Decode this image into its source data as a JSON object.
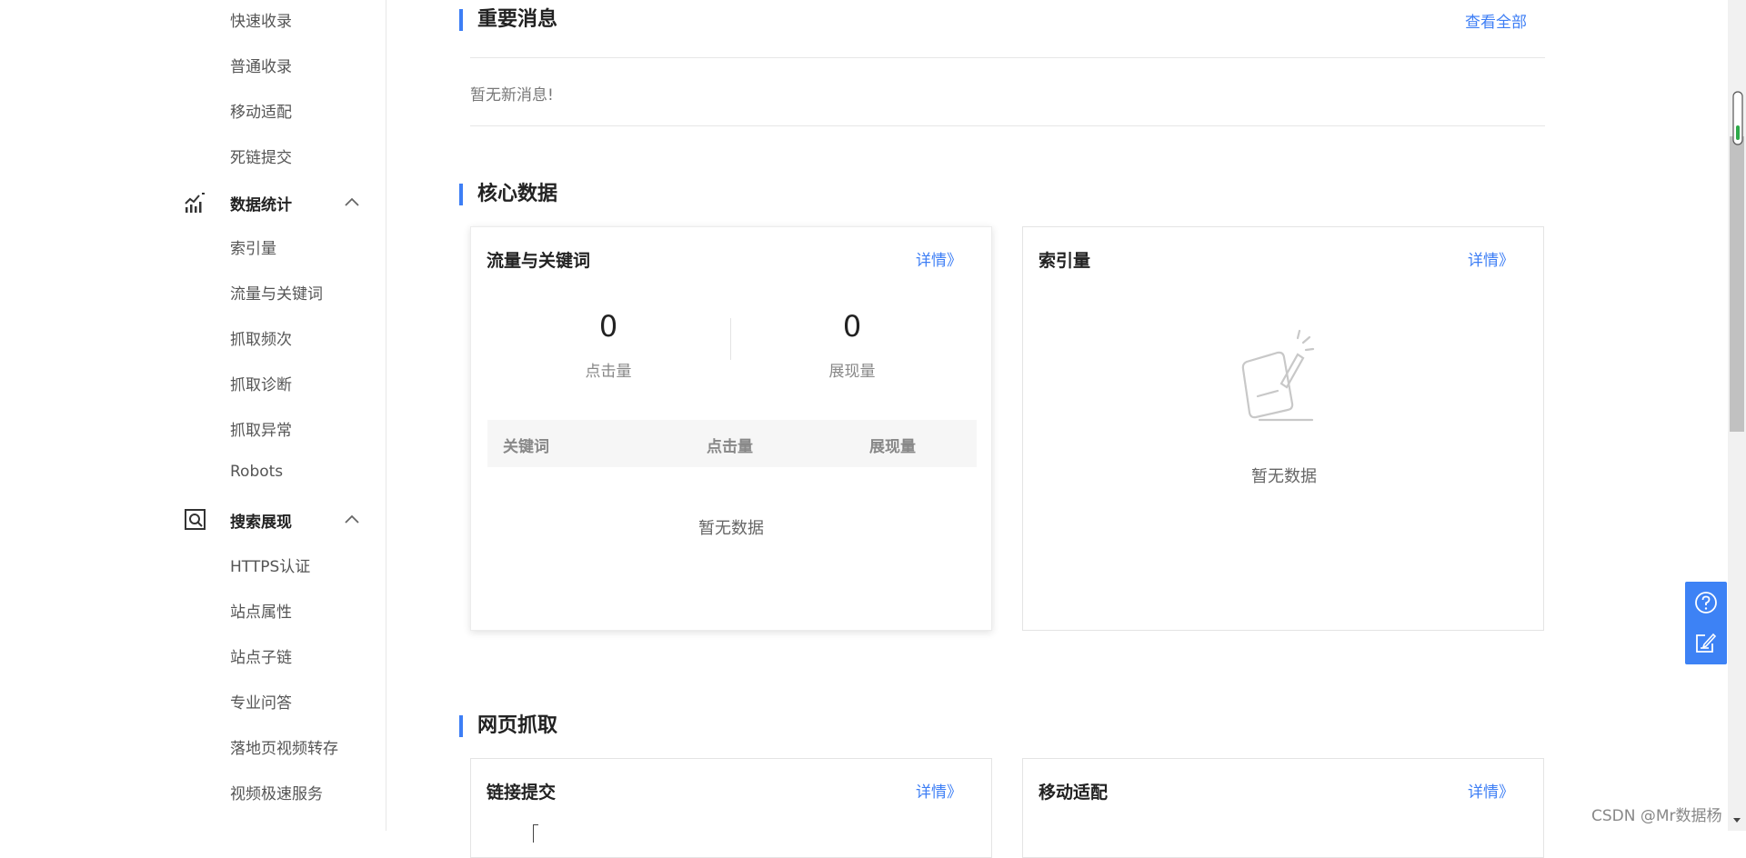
{
  "sidebar": {
    "items_top": [
      "快速收录",
      "普通收录",
      "移动适配",
      "死链提交"
    ],
    "group_stats": {
      "label": "数据统计",
      "icon": "chart-icon"
    },
    "items_stats": [
      "索引量",
      "流量与关键词",
      "抓取频次",
      "抓取诊断",
      "抓取异常",
      "Robots"
    ],
    "group_search": {
      "label": "搜索展现",
      "icon": "search-display-icon"
    },
    "items_search": [
      "HTTPS认证",
      "站点属性",
      "站点子链",
      "专业问答",
      "落地页视频转存",
      "视频极速服务"
    ]
  },
  "important": {
    "title": "重要消息",
    "view_all": "查看全部",
    "empty": "暂无新消息!"
  },
  "core": {
    "title": "核心数据",
    "traffic": {
      "title": "流量与关键词",
      "more": "详情》",
      "clicks_value": "0",
      "clicks_label": "点击量",
      "impressions_value": "0",
      "impressions_label": "展现量",
      "columns": [
        "关键词",
        "点击量",
        "展现量"
      ],
      "empty": "暂无数据"
    },
    "index": {
      "title": "索引量",
      "more": "详情》",
      "empty": "暂无数据"
    }
  },
  "crawl": {
    "title": "网页抓取",
    "link_submit": {
      "title": "链接提交",
      "more": "详情》"
    },
    "mobile": {
      "title": "移动适配",
      "more": "详情》"
    }
  },
  "watermark": "CSDN @Mr数据杨",
  "colors": {
    "accent": "#3d7ef5",
    "floatbar": "#3d82f5"
  }
}
